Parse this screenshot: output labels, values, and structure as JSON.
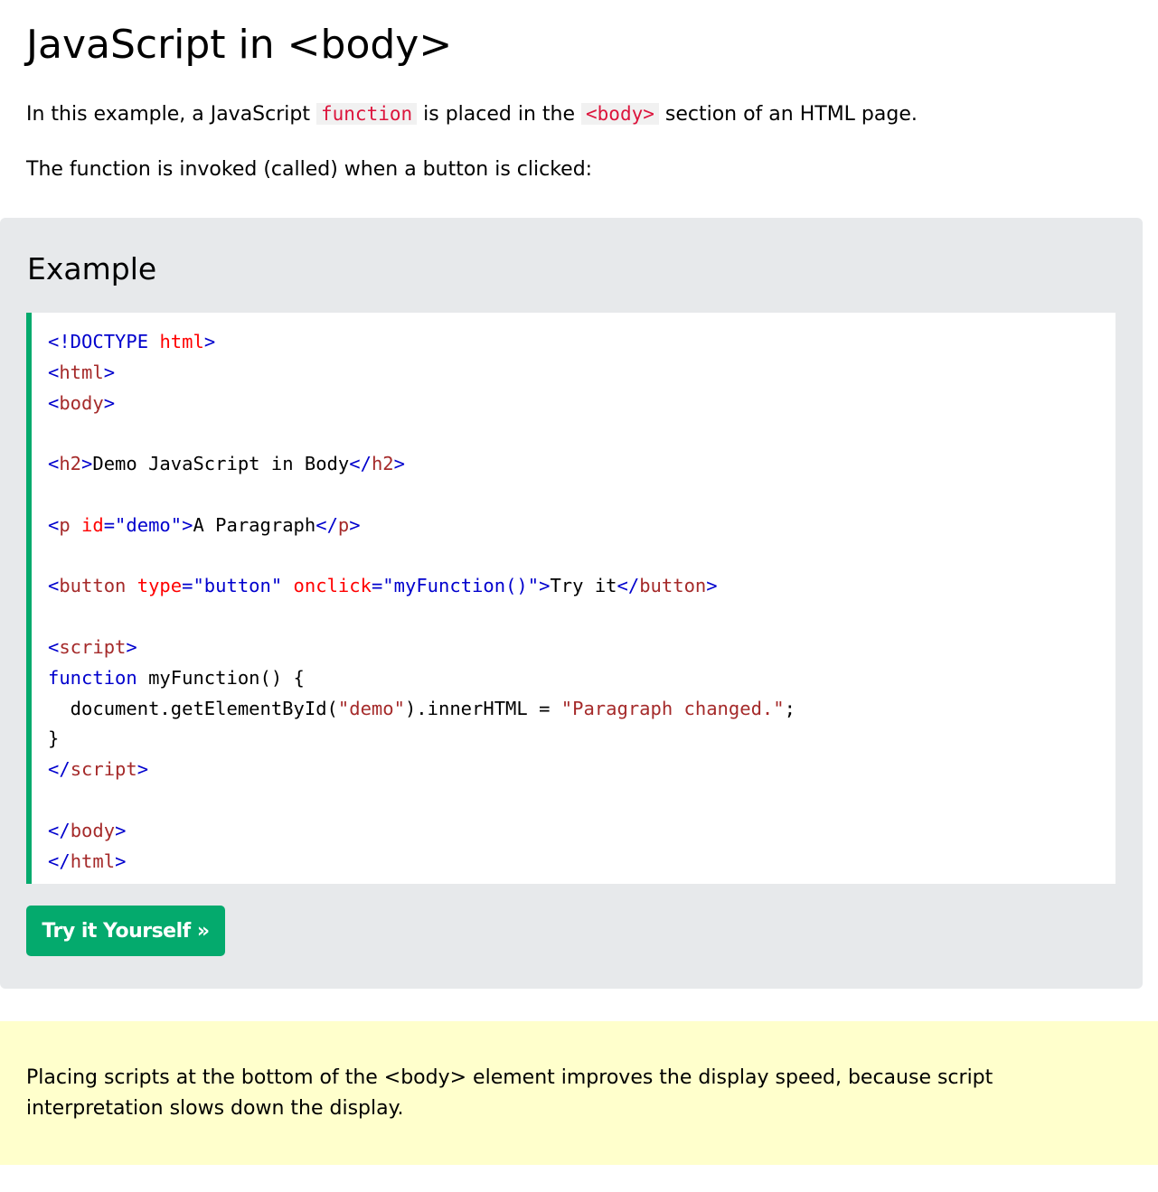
{
  "page": {
    "title": "JavaScript in <body>"
  },
  "intro": {
    "p1_before": "In this example, a JavaScript ",
    "p1_code1": "function",
    "p1_middle": " is placed in the ",
    "p1_code2": "<body>",
    "p1_after": " section of an HTML page.",
    "p2": "The function is invoked (called) when a button is clicked:"
  },
  "example": {
    "heading": "Example",
    "code": {
      "l1_a": "<",
      "l1_b": "!DOCTYPE ",
      "l1_c": "html",
      "l1_d": ">",
      "l2_a": "<",
      "l2_b": "html",
      "l2_c": ">",
      "l3_a": "<",
      "l3_b": "body",
      "l3_c": ">",
      "l5_a": "<",
      "l5_b": "h2",
      "l5_c": ">",
      "l5_d": "Demo JavaScript in Body",
      "l5_e": "</",
      "l5_f": "h2",
      "l5_g": ">",
      "l7_a": "<",
      "l7_b": "p",
      "l7_c": " id",
      "l7_d": "=\"demo\"",
      "l7_e": ">",
      "l7_f": "A Paragraph",
      "l7_g": "</",
      "l7_h": "p",
      "l7_i": ">",
      "l9_a": "<",
      "l9_b": "button",
      "l9_c": " type",
      "l9_d": "=\"button\"",
      "l9_e": " onclick",
      "l9_f": "=\"myFunction()\"",
      "l9_g": ">",
      "l9_h": "Try it",
      "l9_i": "</",
      "l9_j": "button",
      "l9_k": ">",
      "l11_a": "<",
      "l11_b": "script",
      "l11_c": ">",
      "l12_a": "function",
      "l12_b": " myFunction() {",
      "l13_a": "  document.getElementById(",
      "l13_b": "\"demo\"",
      "l13_c": ").innerHTML = ",
      "l13_d": "\"Paragraph changed.\"",
      "l13_e": ";",
      "l14": "}",
      "l15_a": "</",
      "l15_b": "script",
      "l15_c": ">",
      "l17_a": "</",
      "l17_b": "body",
      "l17_c": ">",
      "l18_a": "</",
      "l18_b": "html",
      "l18_c": ">"
    },
    "try_button_label": "Try it Yourself »"
  },
  "note": {
    "text": "Placing scripts at the bottom of the <body> element improves the display speed, because script interpretation slows down the display."
  },
  "colors": {
    "accent_green": "#04aa6d",
    "example_bg": "#e7e9eb",
    "note_bg": "#ffffcc",
    "inline_code": "#dc143c"
  }
}
